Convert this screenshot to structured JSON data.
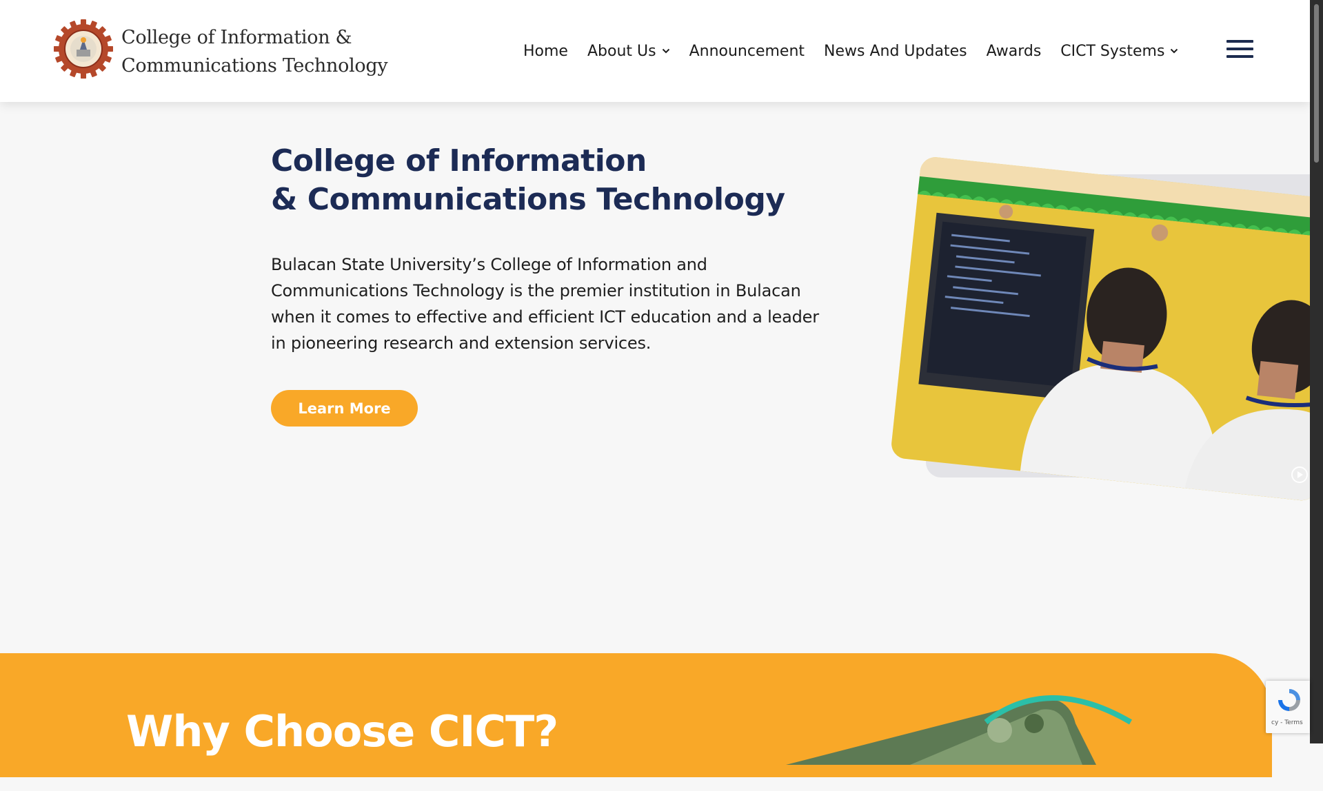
{
  "logo": {
    "line1": "College of Information &",
    "line2": "Communications Technology",
    "seal_icon": "cict-seal-icon"
  },
  "nav": {
    "items": [
      {
        "label": "Home",
        "dropdown": false
      },
      {
        "label": "About Us",
        "dropdown": true
      },
      {
        "label": "Announcement",
        "dropdown": false
      },
      {
        "label": "News And Updates",
        "dropdown": false
      },
      {
        "label": "Awards",
        "dropdown": false
      },
      {
        "label": "CICT Systems",
        "dropdown": true
      }
    ],
    "menu_icon": "hamburger-menu-icon"
  },
  "hero": {
    "title_line1": "College of Information",
    "title_line2": "& Communications Technology",
    "description": "Bulacan State University’s College of Information and Communications Technology is the premier institution in Bulacan when it comes to effective and efficient ICT education and a leader in pioneering research and extension services.",
    "cta_label": "Learn More"
  },
  "section2": {
    "heading": "Why Choose CICT?"
  },
  "recaptcha": {
    "text": "cy - Terms"
  },
  "colors": {
    "accent_orange": "#f9a828",
    "navy": "#1c2b55",
    "page_bg": "#f7f7f7",
    "header_bg": "#ffffff",
    "teal_ring": "#2bbfa8"
  }
}
